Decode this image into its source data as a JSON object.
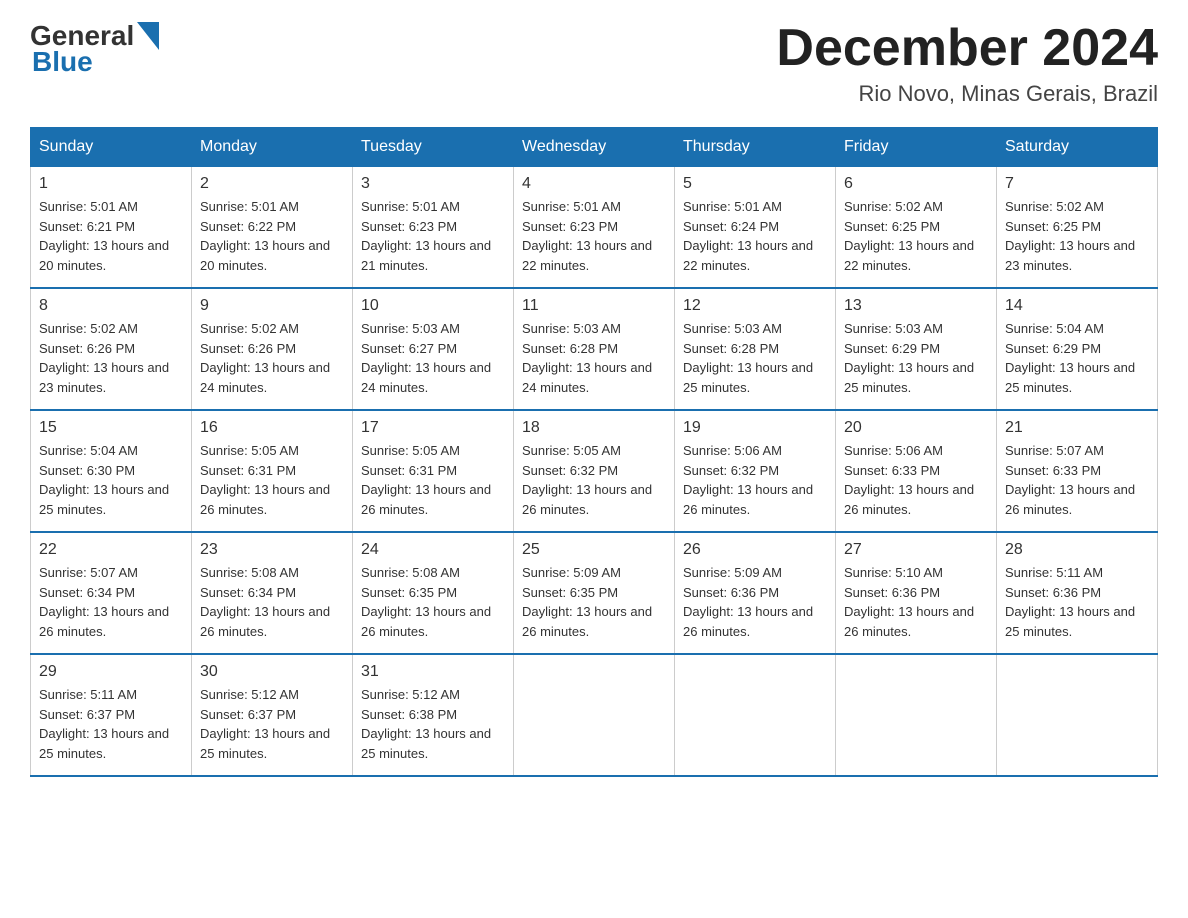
{
  "header": {
    "logo_general": "General",
    "logo_blue": "Blue",
    "month_title": "December 2024",
    "location": "Rio Novo, Minas Gerais, Brazil"
  },
  "days_of_week": [
    "Sunday",
    "Monday",
    "Tuesday",
    "Wednesday",
    "Thursday",
    "Friday",
    "Saturday"
  ],
  "weeks": [
    [
      {
        "day": "1",
        "sunrise": "Sunrise: 5:01 AM",
        "sunset": "Sunset: 6:21 PM",
        "daylight": "Daylight: 13 hours and 20 minutes."
      },
      {
        "day": "2",
        "sunrise": "Sunrise: 5:01 AM",
        "sunset": "Sunset: 6:22 PM",
        "daylight": "Daylight: 13 hours and 20 minutes."
      },
      {
        "day": "3",
        "sunrise": "Sunrise: 5:01 AM",
        "sunset": "Sunset: 6:23 PM",
        "daylight": "Daylight: 13 hours and 21 minutes."
      },
      {
        "day": "4",
        "sunrise": "Sunrise: 5:01 AM",
        "sunset": "Sunset: 6:23 PM",
        "daylight": "Daylight: 13 hours and 22 minutes."
      },
      {
        "day": "5",
        "sunrise": "Sunrise: 5:01 AM",
        "sunset": "Sunset: 6:24 PM",
        "daylight": "Daylight: 13 hours and 22 minutes."
      },
      {
        "day": "6",
        "sunrise": "Sunrise: 5:02 AM",
        "sunset": "Sunset: 6:25 PM",
        "daylight": "Daylight: 13 hours and 22 minutes."
      },
      {
        "day": "7",
        "sunrise": "Sunrise: 5:02 AM",
        "sunset": "Sunset: 6:25 PM",
        "daylight": "Daylight: 13 hours and 23 minutes."
      }
    ],
    [
      {
        "day": "8",
        "sunrise": "Sunrise: 5:02 AM",
        "sunset": "Sunset: 6:26 PM",
        "daylight": "Daylight: 13 hours and 23 minutes."
      },
      {
        "day": "9",
        "sunrise": "Sunrise: 5:02 AM",
        "sunset": "Sunset: 6:26 PM",
        "daylight": "Daylight: 13 hours and 24 minutes."
      },
      {
        "day": "10",
        "sunrise": "Sunrise: 5:03 AM",
        "sunset": "Sunset: 6:27 PM",
        "daylight": "Daylight: 13 hours and 24 minutes."
      },
      {
        "day": "11",
        "sunrise": "Sunrise: 5:03 AM",
        "sunset": "Sunset: 6:28 PM",
        "daylight": "Daylight: 13 hours and 24 minutes."
      },
      {
        "day": "12",
        "sunrise": "Sunrise: 5:03 AM",
        "sunset": "Sunset: 6:28 PM",
        "daylight": "Daylight: 13 hours and 25 minutes."
      },
      {
        "day": "13",
        "sunrise": "Sunrise: 5:03 AM",
        "sunset": "Sunset: 6:29 PM",
        "daylight": "Daylight: 13 hours and 25 minutes."
      },
      {
        "day": "14",
        "sunrise": "Sunrise: 5:04 AM",
        "sunset": "Sunset: 6:29 PM",
        "daylight": "Daylight: 13 hours and 25 minutes."
      }
    ],
    [
      {
        "day": "15",
        "sunrise": "Sunrise: 5:04 AM",
        "sunset": "Sunset: 6:30 PM",
        "daylight": "Daylight: 13 hours and 25 minutes."
      },
      {
        "day": "16",
        "sunrise": "Sunrise: 5:05 AM",
        "sunset": "Sunset: 6:31 PM",
        "daylight": "Daylight: 13 hours and 26 minutes."
      },
      {
        "day": "17",
        "sunrise": "Sunrise: 5:05 AM",
        "sunset": "Sunset: 6:31 PM",
        "daylight": "Daylight: 13 hours and 26 minutes."
      },
      {
        "day": "18",
        "sunrise": "Sunrise: 5:05 AM",
        "sunset": "Sunset: 6:32 PM",
        "daylight": "Daylight: 13 hours and 26 minutes."
      },
      {
        "day": "19",
        "sunrise": "Sunrise: 5:06 AM",
        "sunset": "Sunset: 6:32 PM",
        "daylight": "Daylight: 13 hours and 26 minutes."
      },
      {
        "day": "20",
        "sunrise": "Sunrise: 5:06 AM",
        "sunset": "Sunset: 6:33 PM",
        "daylight": "Daylight: 13 hours and 26 minutes."
      },
      {
        "day": "21",
        "sunrise": "Sunrise: 5:07 AM",
        "sunset": "Sunset: 6:33 PM",
        "daylight": "Daylight: 13 hours and 26 minutes."
      }
    ],
    [
      {
        "day": "22",
        "sunrise": "Sunrise: 5:07 AM",
        "sunset": "Sunset: 6:34 PM",
        "daylight": "Daylight: 13 hours and 26 minutes."
      },
      {
        "day": "23",
        "sunrise": "Sunrise: 5:08 AM",
        "sunset": "Sunset: 6:34 PM",
        "daylight": "Daylight: 13 hours and 26 minutes."
      },
      {
        "day": "24",
        "sunrise": "Sunrise: 5:08 AM",
        "sunset": "Sunset: 6:35 PM",
        "daylight": "Daylight: 13 hours and 26 minutes."
      },
      {
        "day": "25",
        "sunrise": "Sunrise: 5:09 AM",
        "sunset": "Sunset: 6:35 PM",
        "daylight": "Daylight: 13 hours and 26 minutes."
      },
      {
        "day": "26",
        "sunrise": "Sunrise: 5:09 AM",
        "sunset": "Sunset: 6:36 PM",
        "daylight": "Daylight: 13 hours and 26 minutes."
      },
      {
        "day": "27",
        "sunrise": "Sunrise: 5:10 AM",
        "sunset": "Sunset: 6:36 PM",
        "daylight": "Daylight: 13 hours and 26 minutes."
      },
      {
        "day": "28",
        "sunrise": "Sunrise: 5:11 AM",
        "sunset": "Sunset: 6:36 PM",
        "daylight": "Daylight: 13 hours and 25 minutes."
      }
    ],
    [
      {
        "day": "29",
        "sunrise": "Sunrise: 5:11 AM",
        "sunset": "Sunset: 6:37 PM",
        "daylight": "Daylight: 13 hours and 25 minutes."
      },
      {
        "day": "30",
        "sunrise": "Sunrise: 5:12 AM",
        "sunset": "Sunset: 6:37 PM",
        "daylight": "Daylight: 13 hours and 25 minutes."
      },
      {
        "day": "31",
        "sunrise": "Sunrise: 5:12 AM",
        "sunset": "Sunset: 6:38 PM",
        "daylight": "Daylight: 13 hours and 25 minutes."
      },
      null,
      null,
      null,
      null
    ]
  ]
}
